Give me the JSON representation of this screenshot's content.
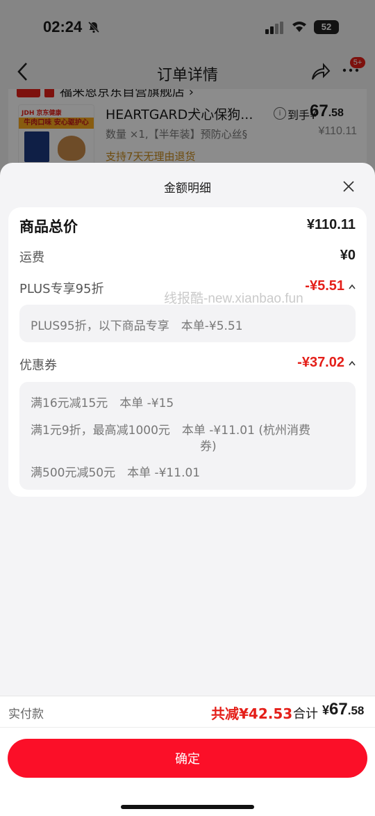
{
  "status_bar": {
    "time": "02:24",
    "battery": "52"
  },
  "nav": {
    "title": "订单详情",
    "more_badge": "5+"
  },
  "background_order": {
    "shop_name": "福来恩京东自营旗舰店 ›",
    "product_image_top": "JDH 京东健康",
    "product_image_band": "牛肉口味 安心驱护心",
    "product_name": "HEARTGARD犬心保狗...",
    "spec": "数量 ×1,【半年装】预防心丝§",
    "support": "支持7天无理由退货",
    "price_prefix": "到手¥",
    "price_int": "67",
    "price_dec": ".58",
    "price_original": "¥110.11"
  },
  "sheet": {
    "title": "金额明细",
    "total_label": "商品总价",
    "total_value": "¥110.11",
    "shipping_label": "运费",
    "shipping_value": "¥0",
    "plus_label": "PLUS专享95折",
    "plus_value": "-¥5.51",
    "plus_detail": "PLUS95折，以下商品专享　本单-¥5.51",
    "coupon_label": "优惠券",
    "coupon_value": "-¥37.02",
    "coupon_details": [
      "满16元减15元　本单 -¥15",
      "满1元9折，最高减1000元　本单 -¥11.01 (杭州消费",
      "券)",
      "满500元减50元　本单 -¥11.01"
    ],
    "watermark": "线报酷-new.xianbao.fun"
  },
  "footer": {
    "paid_label": "实付款",
    "saved": "共减¥42.53",
    "sum_label": "合计",
    "sum_currency": "¥",
    "sum_int": "67",
    "sum_dec": ".58",
    "confirm_label": "确定"
  },
  "colors": {
    "accent": "#e41f19",
    "button": "#fb0f28",
    "sheet_bg": "#f4f4f6"
  }
}
